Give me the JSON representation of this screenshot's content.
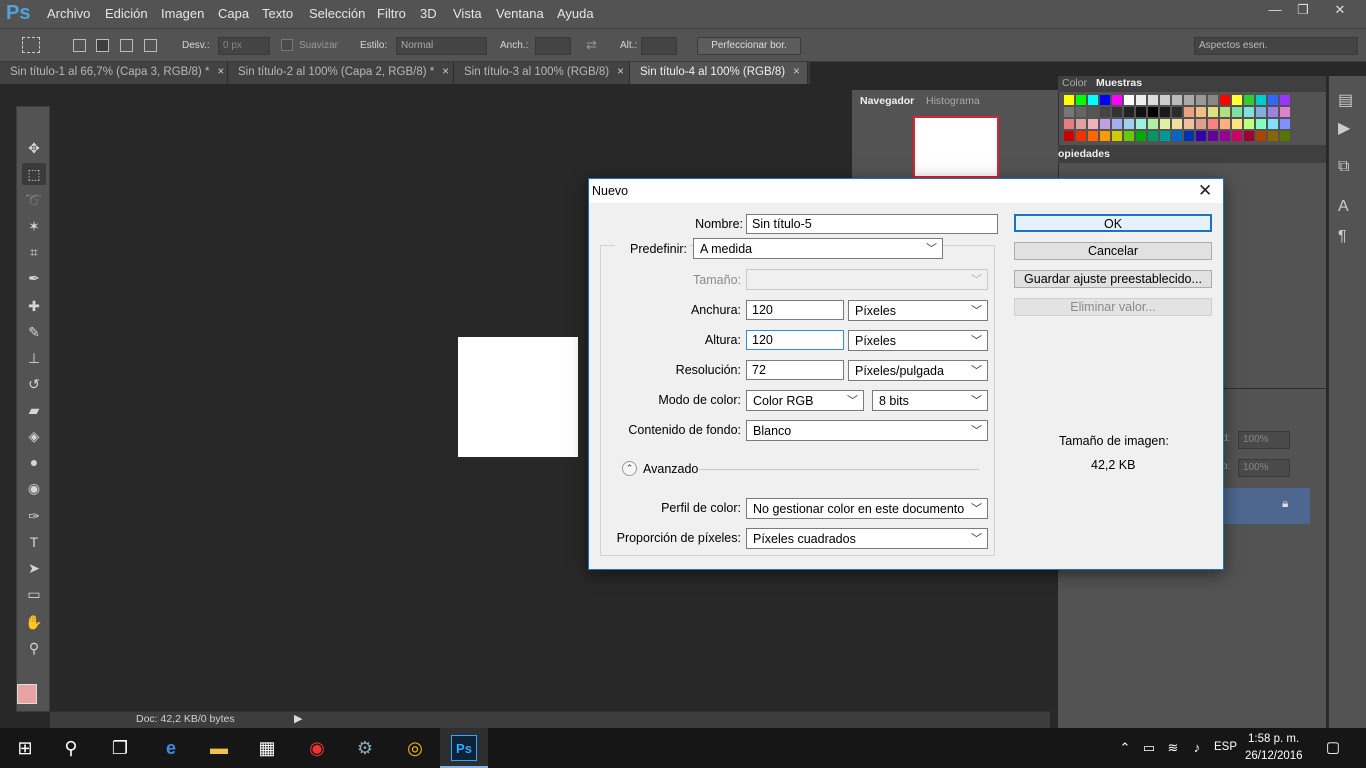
{
  "app": {
    "logo": "Ps",
    "menu": [
      "Archivo",
      "Edición",
      "Imagen",
      "Capa",
      "Texto",
      "Selección",
      "Filtro",
      "3D",
      "Vista",
      "Ventana",
      "Ayuda"
    ],
    "window_controls": {
      "minimize": "—",
      "restore": "❐",
      "close": "✕"
    }
  },
  "options_bar": {
    "feather_label": "Desv.:",
    "feather_placeholder": "0 px",
    "antialias_label": "Suavizar",
    "style_label": "Estilo:",
    "style_value": "Normal",
    "width_label": "Anch.:",
    "height_label": "Alt.:",
    "refine_button": "Perfeccionar bor.",
    "workspace_value": "Aspectos esen."
  },
  "doc_tabs": [
    {
      "label": "Sin título-1 al 66,7% (Capa 3, RGB/8) *",
      "active": false
    },
    {
      "label": "Sin título-2 al 100% (Capa 2, RGB/8) *",
      "active": false
    },
    {
      "label": "Sin título-3 al 100% (RGB/8)",
      "active": false
    },
    {
      "label": "Sin título-4 al 100% (RGB/8)",
      "active": true
    }
  ],
  "tab_close": "×",
  "status_bar": {
    "text": "Doc: 42,2 KB/0 bytes"
  },
  "panels": {
    "navigator_tab": "Navegador",
    "histogram_tab": "Histograma",
    "color_tab": "Color",
    "swatches_tab": "Muestras",
    "properties_tab": "opiedades",
    "layers_opacity": "100%",
    "layers_fill": "100%",
    "layers_opacity_label": "d:",
    "layers_fill_label": "o:"
  },
  "swatch_colors": [
    [
      "#ffff00",
      "#00ff00",
      "#00ffff",
      "#0000ff",
      "#ff00ff",
      "#ffffff",
      "#eeeeee",
      "#dddddd",
      "#cccccc",
      "#bbbbbb",
      "#aaaaaa",
      "#999999",
      "#888888",
      "#ff0000",
      "#ffff33",
      "#33cc33",
      "#00cccc",
      "#3366ff",
      "#9933ff"
    ],
    [
      "#777777",
      "#666666",
      "#555555",
      "#444444",
      "#333333",
      "#222222",
      "#111111",
      "#000000",
      "#1a1a1a",
      "#2b2b2b",
      "#f0a080",
      "#f0c080",
      "#e0e080",
      "#b0e080",
      "#80e0a0",
      "#80e0e0",
      "#80b0e0",
      "#a080e0",
      "#e080d0"
    ],
    [
      "#e08080",
      "#e0a0a0",
      "#f0b0c0",
      "#c0a0e0",
      "#a0b0f0",
      "#a0d0f0",
      "#a0f0e0",
      "#b0f0a0",
      "#e0f0a0",
      "#f0e0a0",
      "#f0c0a0",
      "#e0a090",
      "#ff8080",
      "#ffb080",
      "#ffe080",
      "#c0ff80",
      "#80ffc0",
      "#80e0ff",
      "#8090ff"
    ],
    [
      "#cc0000",
      "#ee3300",
      "#ff6600",
      "#ff9900",
      "#cccc00",
      "#66cc00",
      "#00aa00",
      "#009966",
      "#009999",
      "#0066cc",
      "#0033aa",
      "#3300aa",
      "#660099",
      "#990099",
      "#cc0066",
      "#990033",
      "#aa4400",
      "#886600",
      "#557700"
    ]
  ],
  "dialog": {
    "title": "Nuevo",
    "close": "✕",
    "name_label": "Nombre:",
    "name_value": "Sin título-5",
    "preset_label": "Predefinir:",
    "preset_value": "A medida",
    "size_label": "Tamaño:",
    "width_label": "Anchura:",
    "width_value": "120",
    "width_unit": "Píxeles",
    "height_label": "Altura:",
    "height_value": "120",
    "height_unit": "Píxeles",
    "resolution_label": "Resolución:",
    "resolution_value": "72",
    "resolution_unit": "Píxeles/pulgada",
    "color_mode_label": "Modo de color:",
    "color_mode_value": "Color RGB",
    "bit_depth_value": "8 bits",
    "background_label": "Contenido de fondo:",
    "background_value": "Blanco",
    "advanced_label": "Avanzado",
    "advanced_toggle": "⌃",
    "color_profile_label": "Perfil de color:",
    "color_profile_value": "No gestionar color en este documento",
    "pixel_aspect_label": "Proporción de píxeles:",
    "pixel_aspect_value": "Píxeles cuadrados",
    "ok_button": "OK",
    "cancel_button": "Cancelar",
    "save_preset_button": "Guardar ajuste preestablecido...",
    "delete_preset_button": "Eliminar valor...",
    "image_size_label": "Tamaño de imagen:",
    "image_size_value": "42,2 KB"
  },
  "taskbar": {
    "time": "1:58 p. m.",
    "date": "26/12/2016",
    "language": "ESP"
  }
}
